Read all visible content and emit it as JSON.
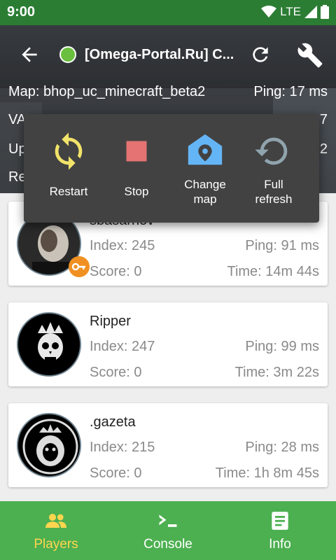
{
  "status_bar": {
    "time": "9:00",
    "network": "LTE"
  },
  "toolbar": {
    "server_title": "[Omega-Portal.Ru] C...",
    "server_status_color": "#6abf3e"
  },
  "server_info": {
    "map": "Map: bhop_uc_minecraft_beta2",
    "ping": "Ping: 17 ms",
    "vac_partial": "VA",
    "players_partial": "7",
    "uptime_partial": "Up",
    "uptime_value_partial": "2",
    "row4_partial": "Re"
  },
  "menu": {
    "items": [
      {
        "label": "Restart",
        "icon": "restart-icon"
      },
      {
        "label": "Stop",
        "icon": "stop-icon"
      },
      {
        "label": "Change map",
        "label_line1": "Change",
        "label_line2": "map",
        "icon": "map-pin-icon"
      },
      {
        "label": "Full refresh",
        "label_line1": "Full",
        "label_line2": "refresh",
        "icon": "refresh-icon"
      }
    ]
  },
  "players": [
    {
      "name": "sbasarnov",
      "index": "Index: 245",
      "score": "Score: 0",
      "ping": "Ping: 91 ms",
      "time": "Time: 14m 44s",
      "admin_key": true
    },
    {
      "name": "Ripper",
      "index": "Index: 247",
      "score": "Score: 0",
      "ping": "Ping: 99 ms",
      "time": "Time: 3m 22s",
      "admin_key": false
    },
    {
      "name": ".gazeta",
      "index": "Index: 215",
      "score": "Score: 0",
      "ping": "Ping: 28 ms",
      "time": "Time: 1h 8m 45s",
      "admin_key": false
    }
  ],
  "bottom_nav": {
    "items": [
      {
        "label": "Players",
        "icon": "players-icon",
        "active": true
      },
      {
        "label": "Console",
        "icon": "console-icon",
        "active": false
      },
      {
        "label": "Info",
        "icon": "info-icon",
        "active": false
      }
    ]
  },
  "colors": {
    "status_bar": "#2b7d34",
    "bottom_nav": "#4caf50",
    "active_nav": "#ffd54f",
    "popup_bg": "#424242",
    "restart_icon": "#f2e36a",
    "stop_icon": "#e57373",
    "map_icon": "#64b5f6",
    "refresh_icon": "#90a4ae",
    "admin_key": "#f09022"
  }
}
